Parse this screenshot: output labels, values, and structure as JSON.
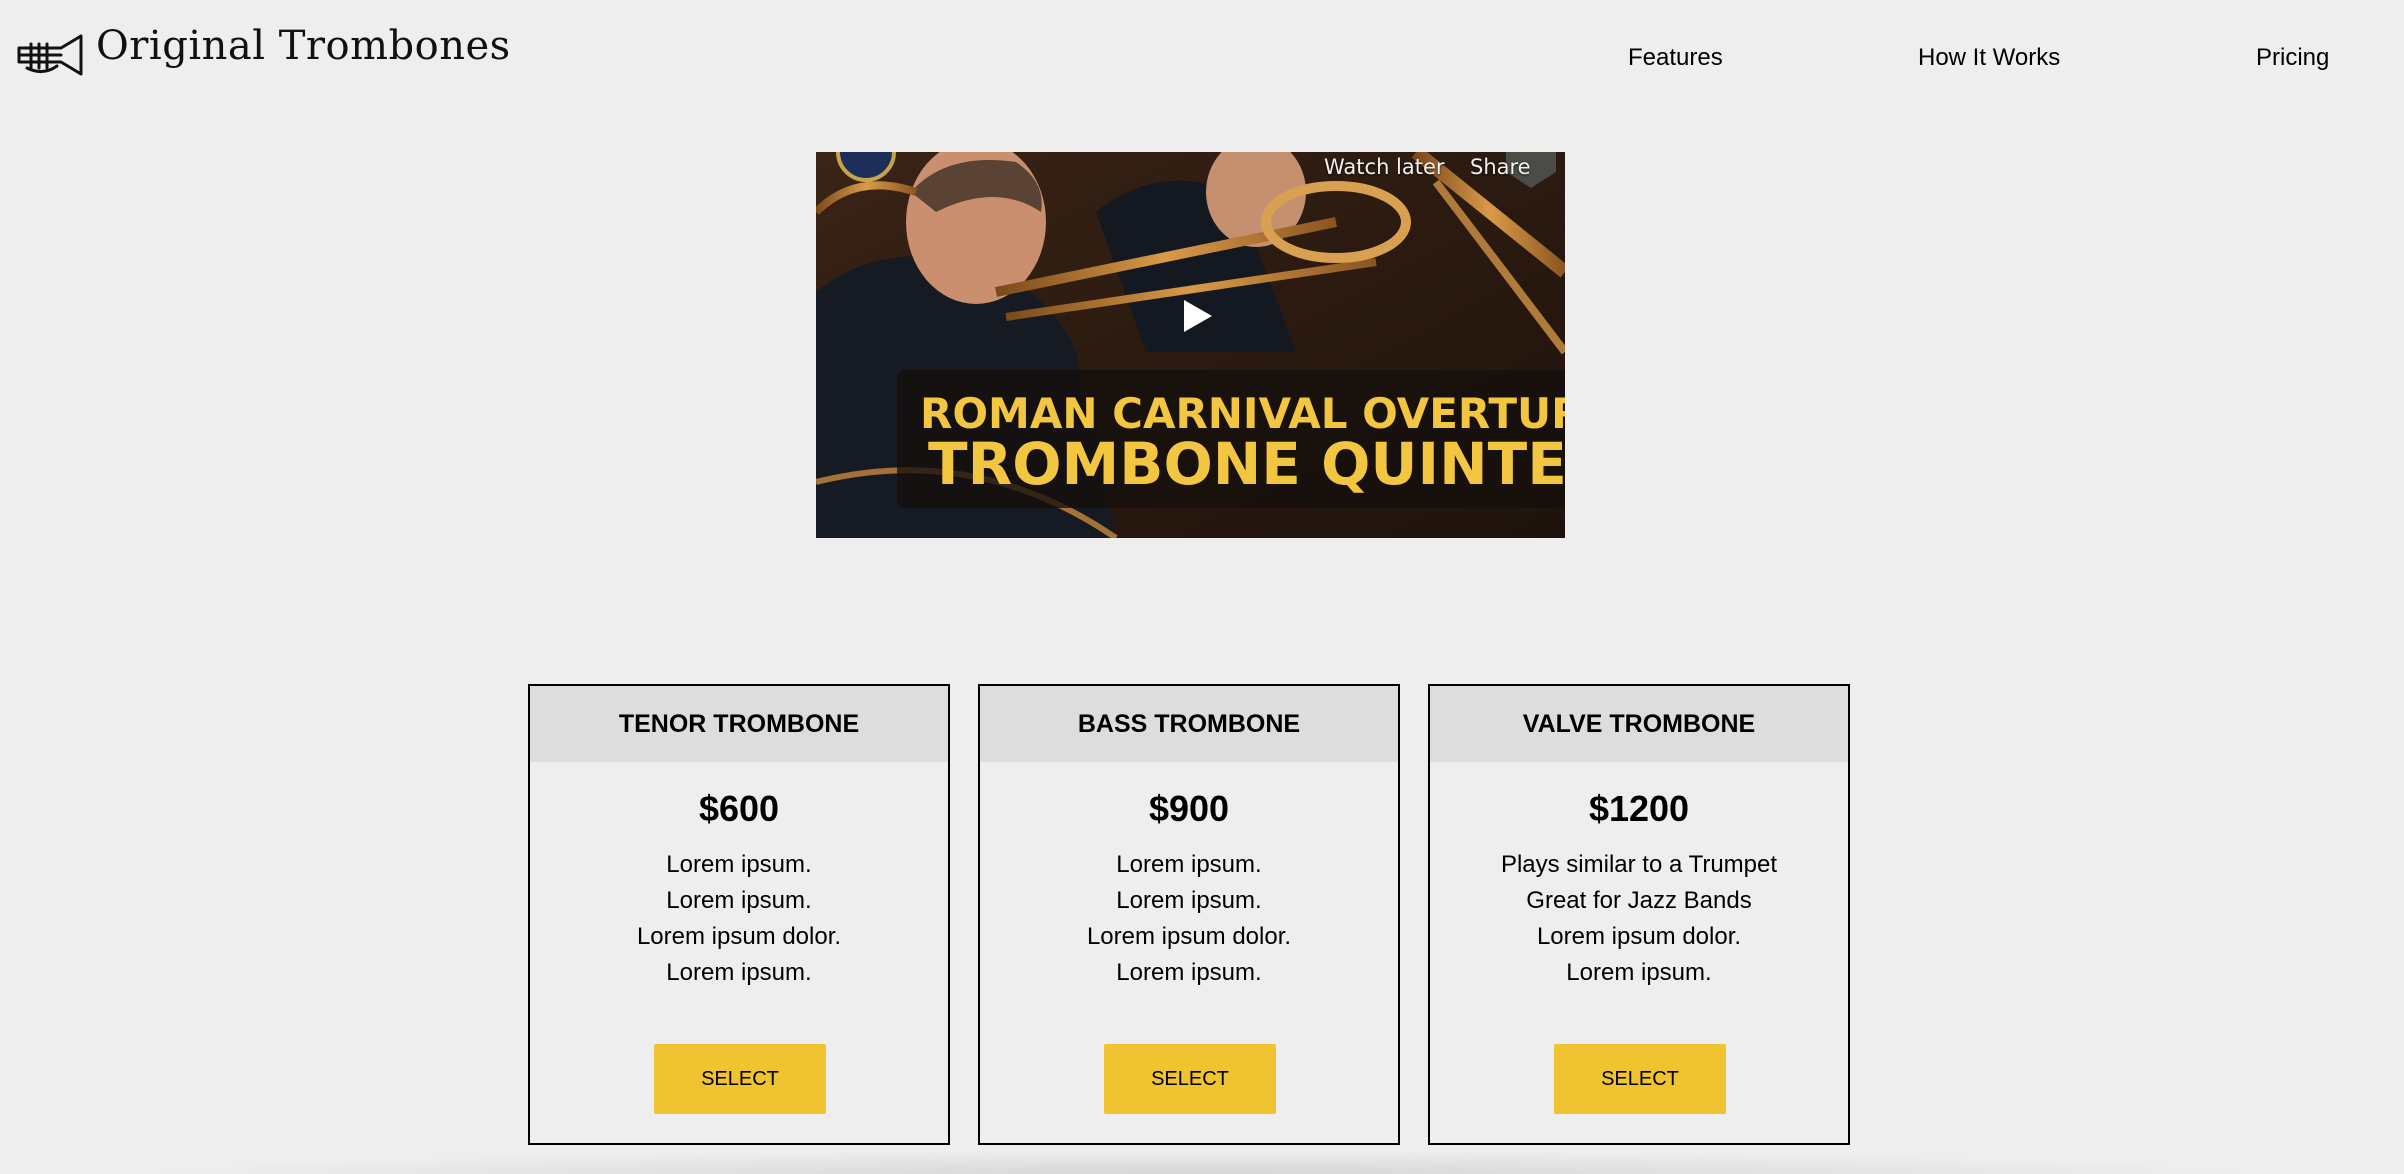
{
  "header": {
    "brand_name": "Original Trombones",
    "nav": [
      {
        "label": "Features"
      },
      {
        "label": "How It Works"
      },
      {
        "label": "Pricing"
      }
    ]
  },
  "video": {
    "watch_later": "Watch later",
    "share": "Share",
    "title_line1": "ROMAN CARNIVAL OVERTURE",
    "title_line2": "TROMBONE QUINTET"
  },
  "pricing": {
    "plans": [
      {
        "name": "TENOR TROMBONE",
        "price": "$600",
        "features": [
          "Lorem ipsum.",
          "Lorem ipsum.",
          "Lorem ipsum dolor.",
          "Lorem ipsum."
        ],
        "button": "SELECT"
      },
      {
        "name": "BASS TROMBONE",
        "price": "$900",
        "features": [
          "Lorem ipsum.",
          "Lorem ipsum.",
          "Lorem ipsum dolor.",
          "Lorem ipsum."
        ],
        "button": "SELECT"
      },
      {
        "name": "VALVE TROMBONE",
        "price": "$1200",
        "features": [
          "Plays similar to a Trumpet",
          "Great for Jazz Bands",
          "Lorem ipsum dolor.",
          "Lorem ipsum."
        ],
        "button": "SELECT"
      }
    ]
  },
  "colors": {
    "background": "#eeeeee",
    "card_header": "#dddddd",
    "button": "#f0c330",
    "video_title": "#f2c640"
  },
  "icons": {
    "logo": "trumpet-icon",
    "play": "play-icon"
  }
}
